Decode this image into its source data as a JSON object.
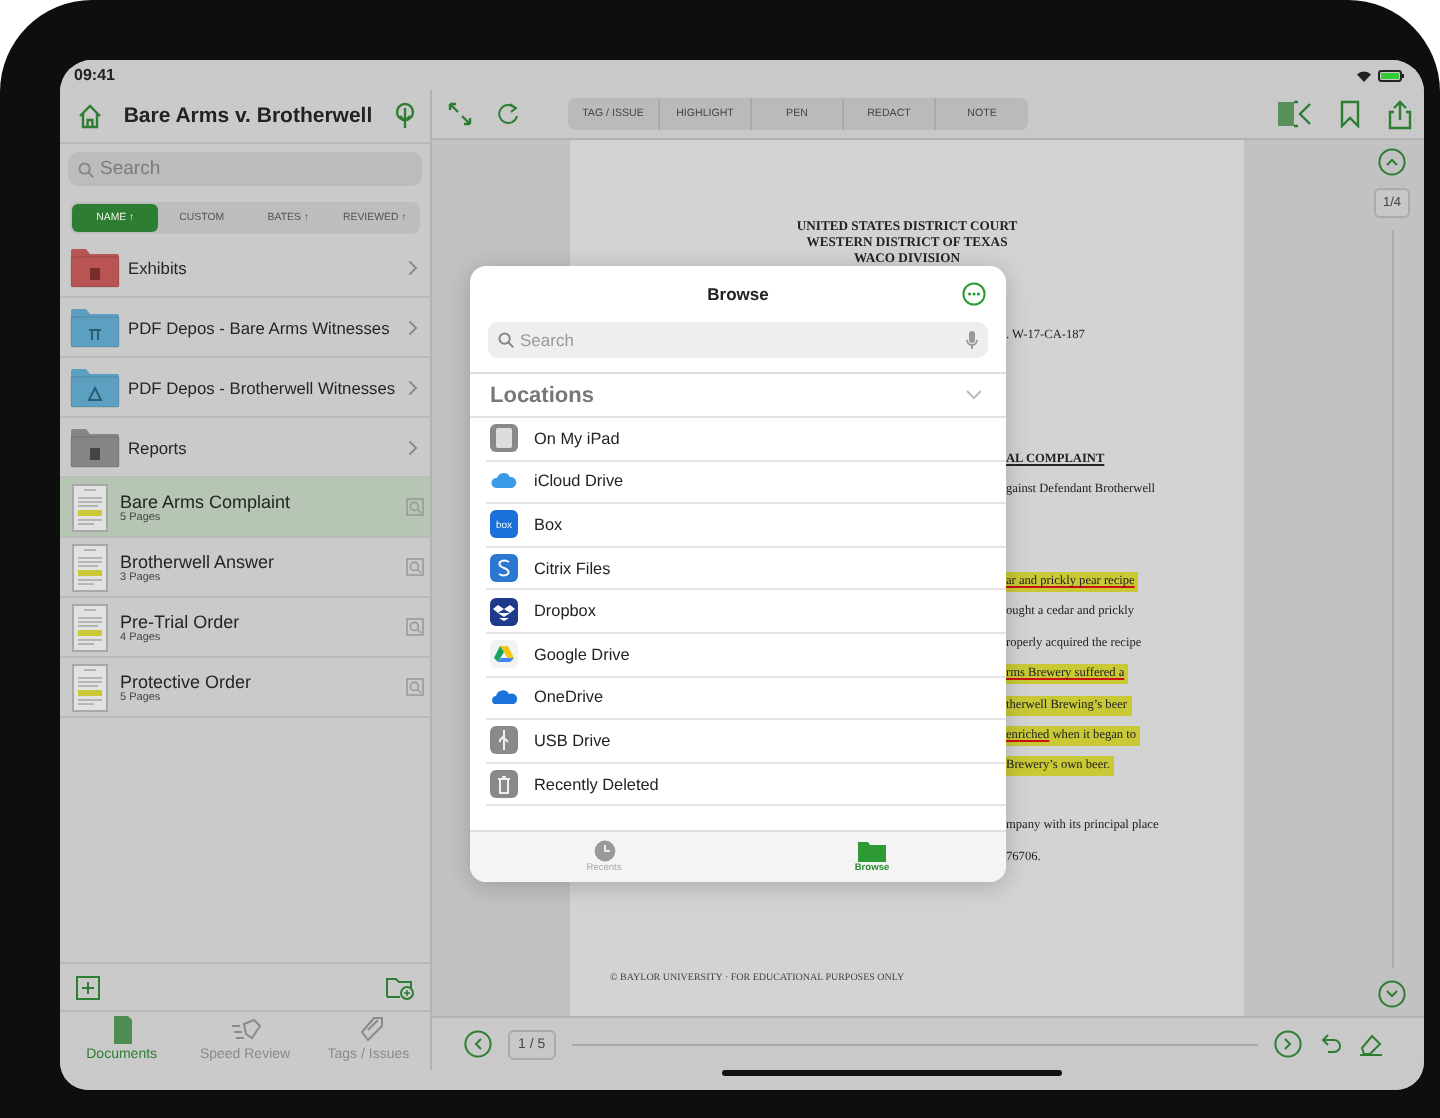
{
  "status_bar": {
    "time": "09:41"
  },
  "sidebar": {
    "title": "Bare Arms v. Brotherwell",
    "search": {
      "placeholder": "Search"
    },
    "sort_options": [
      {
        "label": "NAME ↑",
        "selected": true
      },
      {
        "label": "CUSTOM",
        "selected": false
      },
      {
        "label": "BATES ↑",
        "selected": false
      },
      {
        "label": "REVIEWED ↑",
        "selected": false
      }
    ],
    "folders": [
      {
        "name": "Exhibits",
        "color": "#b85454",
        "kind": "exhibit"
      },
      {
        "name": "PDF Depos - Bare Arms Witnesses",
        "color": "#5c9fc0",
        "kind": "pi"
      },
      {
        "name": "PDF Depos - Brotherwell Witnesses",
        "color": "#5c9fc0",
        "kind": "triangle"
      },
      {
        "name": "Reports",
        "color": "#858585",
        "kind": "report"
      }
    ],
    "documents": [
      {
        "name": "Bare Arms Complaint",
        "pages": "5 Pages",
        "selected": true
      },
      {
        "name": "Brotherwell Answer",
        "pages": "3 Pages",
        "selected": false
      },
      {
        "name": "Pre-Trial Order",
        "pages": "4 Pages",
        "selected": false
      },
      {
        "name": "Protective Order",
        "pages": "5 Pages",
        "selected": false
      }
    ],
    "tabs": [
      {
        "label": "Documents",
        "selected": true,
        "kind": "documents"
      },
      {
        "label": "Speed Review",
        "selected": false,
        "kind": "speed"
      },
      {
        "label": "Tags / Issues",
        "selected": false,
        "kind": "tags"
      }
    ]
  },
  "toolbar": {
    "tools": [
      "TAG / ISSUE",
      "HIGHLIGHT",
      "PEN",
      "REDACT",
      "NOTE"
    ]
  },
  "document": {
    "heading": [
      "UNITED STATES DISTRICT COURT",
      "WESTERN DISTRICT OF TEXAS",
      "WACO DIVISION"
    ],
    "lines": [
      {
        "parts": [
          {
            "text": ". W-17-CA-187",
            "underlined": false
          }
        ],
        "highlighted": false,
        "bold": false
      },
      {
        "parts": [
          {
            "text": "AL COMPLAINT",
            "underlined": false
          }
        ],
        "highlighted": false,
        "bold": true
      },
      {
        "parts": [
          {
            "text": "gainst Defendant Brotherwell",
            "underlined": false
          }
        ],
        "highlighted": false,
        "bold": false
      },
      {
        "parts": [
          {
            "text": "ar and prickly pear recipe",
            "underlined": true
          }
        ],
        "highlighted": true,
        "bold": false
      },
      {
        "parts": [
          {
            "text": "ought a cedar and prickly",
            "underlined": false
          }
        ],
        "highlighted": false,
        "bold": false
      },
      {
        "parts": [
          {
            "text": "roperly acquired the recipe",
            "underlined": false
          }
        ],
        "highlighted": false,
        "bold": false
      },
      {
        "parts": [
          {
            "text": "rms Brewery suffered a",
            "underlined": true
          }
        ],
        "highlighted": true,
        "bold": false
      },
      {
        "parts": [
          {
            "text": "therwell Brewing’s beer",
            "underlined": false
          }
        ],
        "highlighted": true,
        "bold": false
      },
      {
        "parts": [
          {
            "text": "enriched",
            "underlined": true
          },
          {
            "text": " when it began to",
            "underlined": false
          }
        ],
        "highlighted": true,
        "bold": false
      },
      {
        "parts": [
          {
            "text": "Brewery’s own beer.",
            "underlined": false
          }
        ],
        "highlighted": true,
        "bold": false
      },
      {
        "parts": [
          {
            "text": "mpany with its principal place",
            "underlined": false
          }
        ],
        "highlighted": false,
        "bold": false
      },
      {
        "parts": [
          {
            "text": "76706.",
            "underlined": false
          }
        ],
        "highlighted": false,
        "bold": false
      }
    ],
    "footer": "© BAYLOR UNIVERSITY · FOR EDUCATIONAL PURPOSES ONLY"
  },
  "page_indicator": "1/4",
  "pager": {
    "page": "1 / 5"
  },
  "browse_dialog": {
    "title": "Browse",
    "search": {
      "placeholder": "Search"
    },
    "section": "Locations",
    "locations": [
      {
        "name": "On My iPad",
        "kind": "ipad"
      },
      {
        "name": "iCloud Drive",
        "kind": "icloud"
      },
      {
        "name": "Box",
        "kind": "box"
      },
      {
        "name": "Citrix Files",
        "kind": "citrix"
      },
      {
        "name": "Dropbox",
        "kind": "dropbox"
      },
      {
        "name": "Google Drive",
        "kind": "gdrive"
      },
      {
        "name": "OneDrive",
        "kind": "onedrive"
      },
      {
        "name": "USB Drive",
        "kind": "usb"
      },
      {
        "name": "Recently Deleted",
        "kind": "trash"
      }
    ],
    "tabs": [
      {
        "label": "Recents",
        "selected": false,
        "kind": "recents"
      },
      {
        "label": "Browse",
        "selected": true,
        "kind": "browse"
      }
    ]
  }
}
